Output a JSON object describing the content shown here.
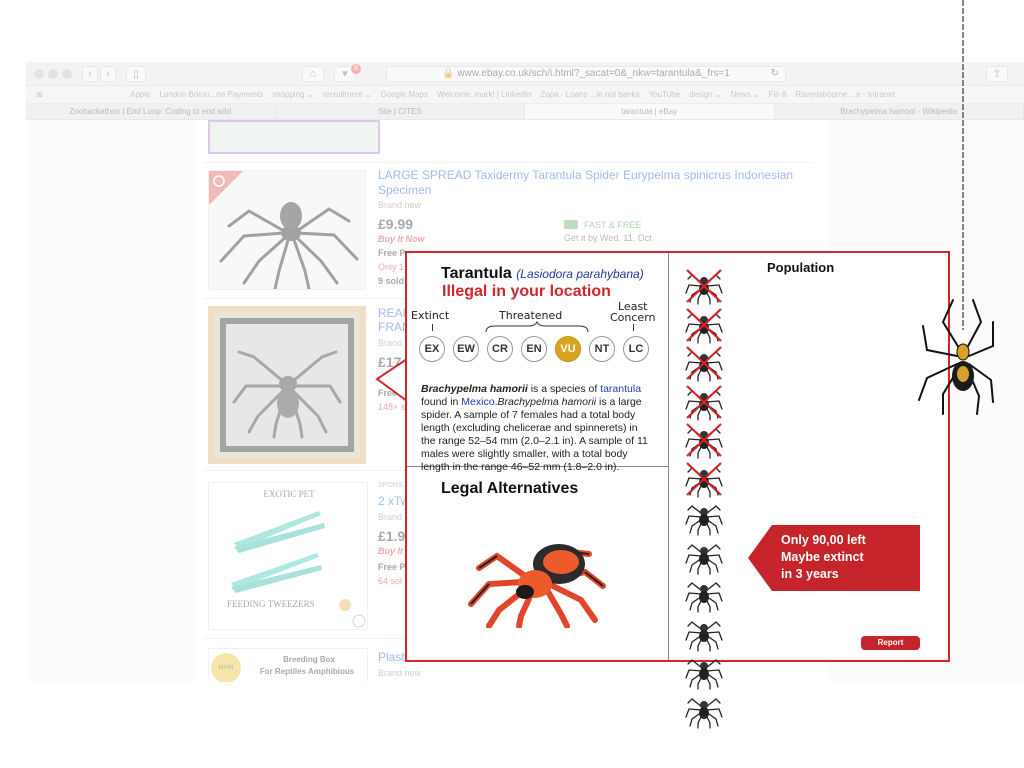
{
  "browser": {
    "url": "www.ebay.co.uk/sch/i.html?_sacat=0&_nkw=tarantula&_frs=1",
    "notification_count": "8",
    "bookmarks": [
      "Apple",
      "London Borou...ne Payments",
      "shopping ⌄",
      "recruitment ⌄",
      "Google Maps",
      "Welcome, mark! | LinkedIn",
      "Zopa - Loans ...le not banks",
      "YouTube",
      "design ⌄",
      "News ⌄",
      "Fin 8",
      "Ravensbourne ...e - Intranet"
    ],
    "tabs": [
      "Zoohackathon | End Loop: Coding to end wild",
      "Site | CITES",
      "tarantula | eBay",
      "Brachypelma hamorii - Wikipedia"
    ],
    "active_tab": 2
  },
  "listings": [
    {
      "title": "LARGE SPREAD Taxidermy Tarantula Spider Eurypelma spinicrus Indonesian Specimen",
      "condition": "Brand new",
      "price": "£9.99",
      "buy_it_now": "Buy It Now",
      "postage": "Free P",
      "stock": "Only 1",
      "sold": "9 sold",
      "shipping_badge": "FAST & FREE",
      "delivery": "Get it by Wed. 11. Oct"
    },
    {
      "title": "REAL",
      "title_line2": "FRAM",
      "condition": "Brand",
      "price": "£17",
      "postage": "Free P",
      "sold": "148+ s"
    },
    {
      "sponsored": "SPONS",
      "title": "2 xTw",
      "condition": "Brand",
      "price": "£1.9",
      "buy_it_now": "Buy It Now",
      "postage": "Free P",
      "sold": "64 sol",
      "image_top": "EXOTIC PET",
      "image_bottom": "FEEDING TWEEZERS"
    },
    {
      "title": "Plast",
      "condition": "Brand new",
      "image_line1": "Breeding Box",
      "image_line2": "For Reptiles Amphibious",
      "badge": "MAIN"
    }
  ],
  "popup": {
    "species_common": "Tarantula",
    "species_latin": "(Lasiodora parahybana)",
    "illegal_text": "Illegal in your location",
    "category_labels": {
      "extinct": "Extinct",
      "threatened": "Threatened",
      "least_line1": "Least",
      "least_line2": "Concern"
    },
    "categories": [
      "EX",
      "EW",
      "CR",
      "EN",
      "VU",
      "NT",
      "LC"
    ],
    "active_category": "VU",
    "active_color": "#d9a521",
    "description": {
      "name": "Brachypelma hamorii",
      "lead1": " is a species of ",
      "link1": "tarantula",
      "lead2": "found in ",
      "link2": "Mexico",
      "body_name": "Brachypelma hamorii",
      "body": " is a large spider. A sample of 7 females had a total body length (excluding chelicerae and spinnerets) in the range 52–54 mm (2.0–2.1 in). A sample of 11 males were slightly smaller, with a total body length in the range 46–52 mm (1.8–2.0 in)."
    },
    "alternatives_title": "Legal Alternatives",
    "population_title": "Population",
    "population_total_icons": 12,
    "population_crossed_icons": 6,
    "callout_line1": "Only 90,00 left",
    "callout_line2": "Maybe extinct",
    "callout_line3": "in 3 years",
    "report_label": "Report",
    "accent_color": "#d0262c"
  }
}
